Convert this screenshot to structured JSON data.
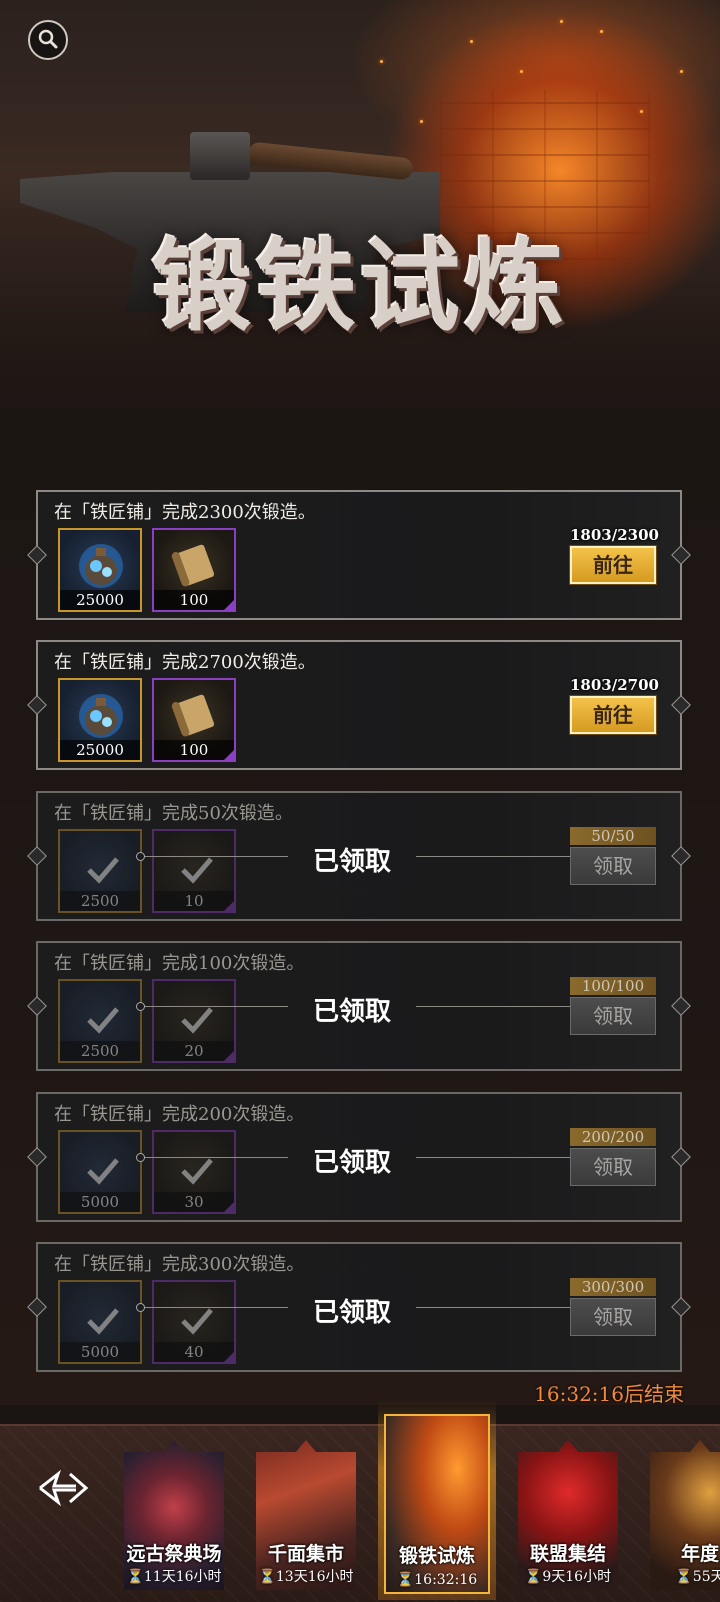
{
  "banner": {
    "title": "锻铁试炼"
  },
  "tasks": [
    {
      "desc": "在「铁匠铺」完成2300次锻造。",
      "progress": "1803/2300",
      "reward1": "25000",
      "reward2": "100",
      "button": "前往",
      "claimed": false
    },
    {
      "desc": "在「铁匠铺」完成2700次锻造。",
      "progress": "1803/2700",
      "reward1": "25000",
      "reward2": "100",
      "button": "前往",
      "claimed": false
    },
    {
      "desc": "在「铁匠铺」完成50次锻造。",
      "progress": "50/50",
      "reward1": "2500",
      "reward2": "10",
      "button": "领取",
      "claimed": true,
      "status": "已领取"
    },
    {
      "desc": "在「铁匠铺」完成100次锻造。",
      "progress": "100/100",
      "reward1": "2500",
      "reward2": "20",
      "button": "领取",
      "claimed": true,
      "status": "已领取"
    },
    {
      "desc": "在「铁匠铺」完成200次锻造。",
      "progress": "200/200",
      "reward1": "5000",
      "reward2": "30",
      "button": "领取",
      "claimed": true,
      "status": "已领取"
    },
    {
      "desc": "在「铁匠铺」完成300次锻造。",
      "progress": "300/300",
      "reward1": "5000",
      "reward2": "40",
      "button": "领取",
      "claimed": true,
      "status": "已领取"
    }
  ],
  "timer": "16:32:16后结束",
  "events": [
    {
      "name": "远古祭典场",
      "time": "⏳11天16小时"
    },
    {
      "name": "千面集市",
      "time": "⏳13天16小时"
    },
    {
      "name": "锻铁试炼",
      "time": "⏳16:32:16"
    },
    {
      "name": "联盟集结",
      "time": "⏳9天16小时"
    },
    {
      "name": "年度",
      "time": "⏳55天"
    }
  ],
  "colors": {
    "accent_gold": "#f3c24a",
    "timer_orange": "#f08a3c",
    "epic_purple": "#8b3fc2",
    "rare_gold": "#c9962c"
  }
}
